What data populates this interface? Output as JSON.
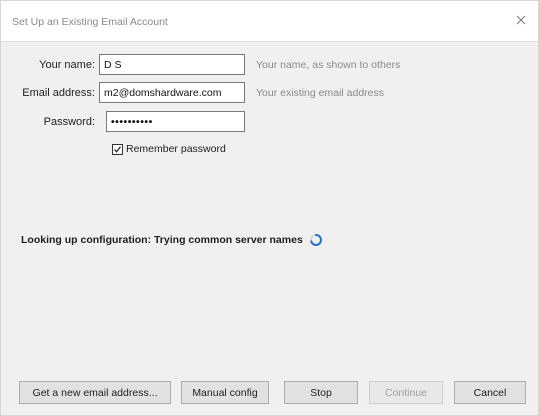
{
  "window": {
    "title": "Set Up an Existing Email Account"
  },
  "form": {
    "name": {
      "label": "Your name:",
      "value": "D S",
      "hint": "Your name, as shown to others"
    },
    "email": {
      "label": "Email address:",
      "value": "m2@domshardware.com",
      "hint": "Your existing email address"
    },
    "password": {
      "label": "Password:",
      "value": "••••••••••"
    },
    "remember": {
      "label": "Remember password",
      "checked": true
    }
  },
  "status": {
    "text": "Looking up configuration: Trying common server names"
  },
  "buttons": {
    "new_email": "Get a new email address...",
    "manual": "Manual config",
    "stop": "Stop",
    "continue": "Continue",
    "cancel": "Cancel"
  },
  "colors": {
    "spinner": "#1f6fd9"
  }
}
